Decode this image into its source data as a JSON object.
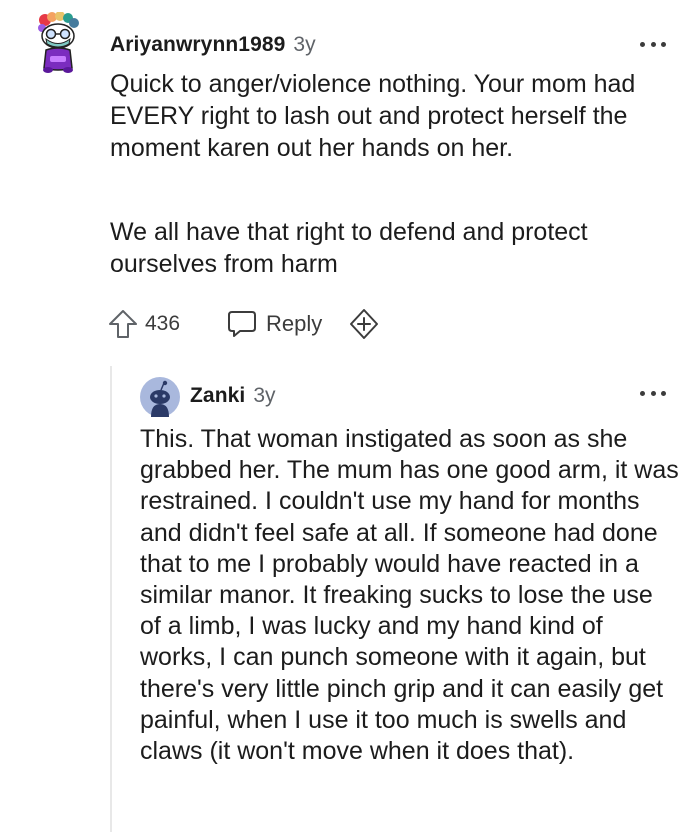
{
  "comment": {
    "author": "Ariyanwrynn1989",
    "age": "3y",
    "paragraphs": [
      "Quick to anger/violence nothing. Your mom had EVERY right to lash out and protect herself the moment karen out her hands on her.",
      "We all have that right to defend and protect ourselves from harm"
    ],
    "votes": "436",
    "reply_label": "Reply",
    "avatar_icon": "snoo-avatar-icon",
    "more_icon": "more-options-icon",
    "upvote_icon": "upvote-arrow-icon",
    "reply_icon": "comment-bubble-icon",
    "award_icon": "award-plus-icon"
  },
  "reply": {
    "author": "Zanki",
    "age": "3y",
    "text": "This. That woman instigated as soon as she grabbed her. The mum has one good arm, it was restrained. I couldn't use my hand for months and didn't feel safe at all. If someone had done that to me I probably would have reacted in a similar manor. It freaking sucks to lose the use of a limb, I was lucky and my hand kind of works, I can punch someone with it again, but there's very little pinch grip and it can easily get painful, when I use it too much is swells and claws (it won't move when it does that).",
    "avatar_icon": "default-reddit-avatar-icon",
    "more_icon": "more-options-icon"
  },
  "colors": {
    "text": "#1c1c1c",
    "muted": "#5f6368",
    "thread_line": "#e8e8e8",
    "avatar_bg": "#a9b8dd"
  }
}
